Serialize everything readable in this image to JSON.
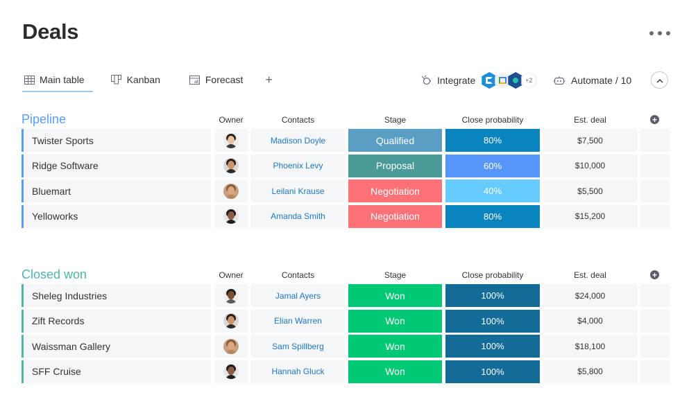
{
  "header": {
    "title": "Deals",
    "more_icon": "more-horizontal-icon"
  },
  "views": {
    "tabs": [
      {
        "label": "Main table",
        "icon": "table-icon",
        "active": true
      },
      {
        "label": "Kanban",
        "icon": "kanban-icon",
        "active": false
      },
      {
        "label": "Forecast",
        "icon": "chart-icon",
        "active": false
      }
    ],
    "add_label": "+"
  },
  "toolbar": {
    "integrate_label": "Integrate",
    "integrate_more": "+2",
    "automate_label": "Automate / 10",
    "collapse_icon": "chevron-up-icon"
  },
  "columns": {
    "owner": "Owner",
    "contacts": "Contacts",
    "stage": "Stage",
    "probability": "Close probability",
    "deal": "Est. deal",
    "add": "+"
  },
  "colors": {
    "pipeline": "#579bfc",
    "closed_won": "#4eb5a6",
    "contact_link": "#1f76c2",
    "cell_bg": "#f5f6f8"
  },
  "groups": [
    {
      "title": "Pipeline",
      "color": "#579bfc",
      "rows": [
        {
          "name": "Twister Sports",
          "owner": "male-1",
          "contact": "Madison Doyle",
          "stage": "Qualified",
          "stage_color": "#5b9ec4",
          "probability": "80%",
          "prob_color": "#0a84bf",
          "deal": "$7,500"
        },
        {
          "name": "Ridge Software",
          "owner": "female-1",
          "contact": "Phoenix Levy",
          "stage": "Proposal",
          "stage_color": "#4a9b98",
          "probability": "60%",
          "prob_color": "#5797fc",
          "deal": "$10,000"
        },
        {
          "name": "Bluemart",
          "owner": "female-2",
          "contact": "Leilani Krause",
          "stage": "Negotiation",
          "stage_color": "#fd7177",
          "probability": "40%",
          "prob_color": "#66ccff",
          "deal": "$5,500"
        },
        {
          "name": "Yelloworks",
          "owner": "male-2",
          "contact": "Amanda Smith",
          "stage": "Negotiation",
          "stage_color": "#fd7177",
          "probability": "80%",
          "prob_color": "#0a84bf",
          "deal": "$15,200"
        }
      ]
    },
    {
      "title": "Closed won",
      "color": "#4eb5a6",
      "rows": [
        {
          "name": "Sheleg Industries",
          "owner": "male-3",
          "contact": "Jamal Ayers",
          "stage": "Won",
          "stage_color": "#00c875",
          "probability": "100%",
          "prob_color": "#136b98",
          "deal": "$24,000"
        },
        {
          "name": "Zift Records",
          "owner": "female-1",
          "contact": "Elian Warren",
          "stage": "Won",
          "stage_color": "#00c875",
          "probability": "100%",
          "prob_color": "#136b98",
          "deal": "$4,000"
        },
        {
          "name": "Waissman Gallery",
          "owner": "female-2",
          "contact": "Sam Spillberg",
          "stage": "Won",
          "stage_color": "#00c875",
          "probability": "100%",
          "prob_color": "#136b98",
          "deal": "$18,100"
        },
        {
          "name": "SFF Cruise",
          "owner": "male-2",
          "contact": "Hannah Gluck",
          "stage": "Won",
          "stage_color": "#00c875",
          "probability": "100%",
          "prob_color": "#136b98",
          "deal": "$5,800"
        }
      ]
    }
  ]
}
